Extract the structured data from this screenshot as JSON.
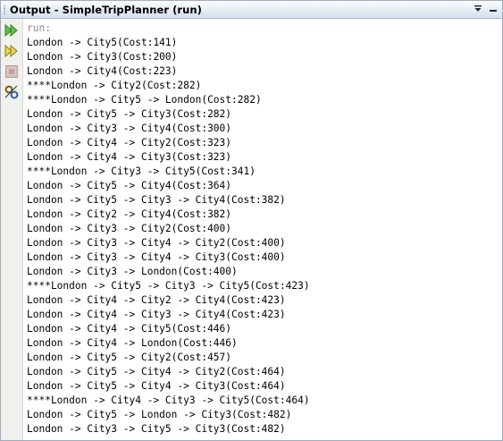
{
  "window": {
    "title": "Output - SimpleTripPlanner (run)",
    "menu_icon": "chevron-down-icon",
    "minimize_icon": "minimize-icon"
  },
  "toolbar": {
    "rerun_icon": "rerun-icon",
    "rerun_with_params_icon": "rerun-with-params-icon",
    "stop_icon": "stop-icon",
    "settings_icon": "settings-icon"
  },
  "output": {
    "lines": [
      "run:",
      "London -> City5(Cost:141)",
      "London -> City3(Cost:200)",
      "London -> City4(Cost:223)",
      "****London -> City2(Cost:282)",
      "****London -> City5 -> London(Cost:282)",
      "London -> City5 -> City3(Cost:282)",
      "London -> City3 -> City4(Cost:300)",
      "London -> City4 -> City2(Cost:323)",
      "London -> City4 -> City3(Cost:323)",
      "****London -> City3 -> City5(Cost:341)",
      "London -> City5 -> City4(Cost:364)",
      "London -> City5 -> City3 -> City4(Cost:382)",
      "London -> City2 -> City4(Cost:382)",
      "London -> City3 -> City2(Cost:400)",
      "London -> City3 -> City4 -> City2(Cost:400)",
      "London -> City3 -> City4 -> City3(Cost:400)",
      "London -> City3 -> London(Cost:400)",
      "****London -> City5 -> City3 -> City5(Cost:423)",
      "London -> City4 -> City2 -> City4(Cost:423)",
      "London -> City4 -> City3 -> City4(Cost:423)",
      "London -> City4 -> City5(Cost:446)",
      "London -> City4 -> London(Cost:446)",
      "London -> City5 -> City2(Cost:457)",
      "London -> City5 -> City4 -> City2(Cost:464)",
      "London -> City5 -> City4 -> City3(Cost:464)",
      "****London -> City4 -> City3 -> City5(Cost:464)",
      "London -> City5 -> London -> City3(Cost:482)",
      "London -> City3 -> City5 -> City3(Cost:482)"
    ]
  },
  "colors": {
    "run_text": "#8c8c8c",
    "output_text": "#000000",
    "rerun_green": "#3fa32f"
  }
}
